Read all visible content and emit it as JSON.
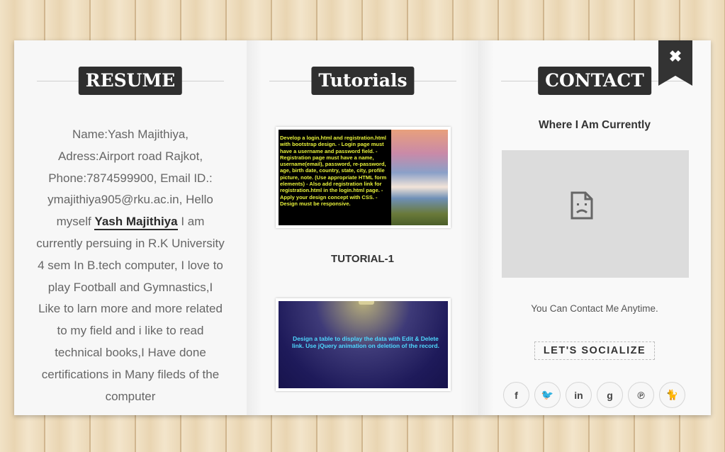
{
  "resume": {
    "heading": "RESUME",
    "text_before": "Name:Yash Majithiya, Adress:Airport road Rajkot, Phone:7874599900, Email ID.: ymajithiya905@rku.ac.in, Hello myself ",
    "name": "Yash Majithiya",
    "text_after": " I am currently persuing in R.K University 4 sem In B.tech computer, I love to play Football and Gymnastics,I Like to larn more and more related to my field and i like to read technical books,I Have done certifications in Many fileds of the computer"
  },
  "tutorials": {
    "heading": "Tutorials",
    "tutorial1": {
      "image_text": "Develop a login.html and registration.html with bootstrap design. - Login page must have a username and password field. - Registration page must have a name, username(email), password, re-password, age, birth date, country, state, city, profile picture, note. (Use appropriate HTML form elements) - Also add registration link for registration.html in the login.html page. - Apply your design concept with CSS. - Design must be responsive.",
      "title": "TUTORIAL-1"
    },
    "tutorial2": {
      "image_text": "Design a table to display the data with Edit & Delete link. Use jQuery animation on deletion of the record."
    }
  },
  "contact": {
    "heading": "CONTACT",
    "where": "Where I Am Currently",
    "map_icon": "broken-document-icon",
    "contact_line": "You Can Contact Me Anytime.",
    "socialize_label": "LET'S SOCIALIZE",
    "social": [
      {
        "icon": "facebook-icon",
        "glyph": "f"
      },
      {
        "icon": "twitter-icon",
        "glyph": "🐦"
      },
      {
        "icon": "linkedin-icon",
        "glyph": "in"
      },
      {
        "icon": "google-plus-icon",
        "glyph": "g"
      },
      {
        "icon": "pinterest-icon",
        "glyph": "℗"
      },
      {
        "icon": "github-icon",
        "glyph": "🐈"
      }
    ]
  },
  "close_ribbon": {
    "icon": "close-icon",
    "glyph": "✖"
  },
  "colors": {
    "heading_bg": "#2f2f2f",
    "panel_bg": "#f9f9f9",
    "map_bg": "#dcdcdc"
  }
}
